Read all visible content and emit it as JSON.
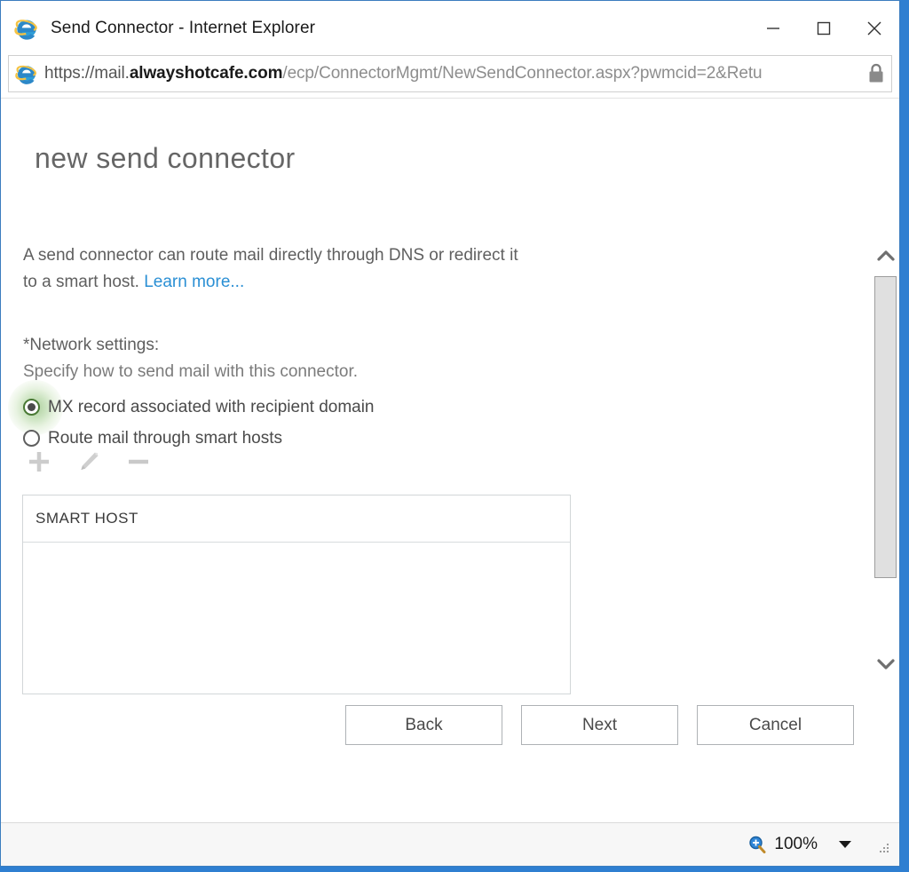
{
  "window": {
    "title": "Send Connector - Internet Explorer",
    "app_icon": "internet-explorer-icon",
    "minimize_label": "Minimize",
    "maximize_label": "Maximize",
    "close_label": "Close"
  },
  "address_bar": {
    "favicon": "internet-explorer-icon",
    "url_scheme": "https://mail.",
    "url_domain": "alwayshotcafe.com",
    "url_path": "/ecp/ConnectorMgmt/NewSendConnector.aspx?pwmcid=2&Retu",
    "url_full": "https://mail.alwayshotcafe.com/ecp/ConnectorMgmt/NewSendConnector.aspx?pwmcid=2&Retu",
    "lock_icon": "lock-icon"
  },
  "page": {
    "title": "new send connector",
    "intro_text": "A send connector can route mail directly through DNS or redirect it to a smart host. ",
    "intro_link": "Learn more...",
    "network_settings_label": "*Network settings:",
    "network_settings_description": "Specify how to send mail with this connector.",
    "radios": [
      {
        "label": "MX record associated with recipient domain",
        "checked": true,
        "highlighted": true
      },
      {
        "label": "Route mail through smart hosts",
        "checked": false,
        "highlighted": false
      }
    ],
    "toolbar": [
      {
        "name": "add-icon",
        "glyph": "+",
        "enabled": false
      },
      {
        "name": "edit-pencil-icon",
        "glyph": "pencil",
        "enabled": false
      },
      {
        "name": "remove-icon",
        "glyph": "-",
        "enabled": false
      }
    ],
    "table": {
      "column_header": "SMART HOST",
      "rows": []
    },
    "buttons": {
      "back": "Back",
      "next": "Next",
      "cancel": "Cancel"
    }
  },
  "statusbar": {
    "zoom_icon": "zoom-magnifier-icon",
    "zoom_level": "100%",
    "caret_icon": "chevron-down-icon",
    "grip_icon": "resize-grip-icon"
  },
  "colors": {
    "link": "#2a8fd4",
    "window_border": "#3b7dbf",
    "desktop": "#2f7fd1",
    "highlight_glow": "#6aa84f",
    "text": "#5f5f5f"
  }
}
